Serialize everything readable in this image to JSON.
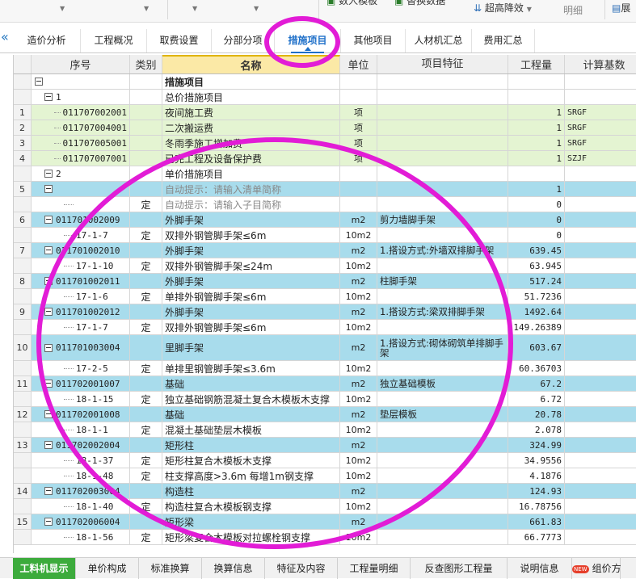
{
  "toolbar": {
    "btn_import": "数人模板",
    "btn_replace": "替换数据",
    "btn_high": "超高降效",
    "btn_detail": "明细",
    "btn_cut": "展"
  },
  "tabs": [
    "造价分析",
    "工程概况",
    "取费设置",
    "分部分项",
    "措施项目",
    "其他项目",
    "人材机汇总",
    "费用汇总"
  ],
  "active_tab": "措施项目",
  "columns": [
    "序号",
    "类别",
    "名称",
    "单位",
    "项目特征",
    "工程量",
    "计算基数"
  ],
  "rows": [
    {
      "idx": "",
      "seq": "",
      "type": "",
      "name": "措施项目",
      "unit": "",
      "feat": "",
      "qty": "",
      "base": "",
      "cls": "root",
      "ind": 0,
      "box": true
    },
    {
      "idx": "",
      "seq": "1",
      "type": "",
      "name": "总价措施项目",
      "unit": "",
      "feat": "",
      "qty": "",
      "base": "",
      "cls": "grp",
      "ind": 1,
      "box": true
    },
    {
      "idx": "1",
      "seq": "011707002001",
      "type": "",
      "name": "夜间施工费",
      "unit": "项",
      "feat": "",
      "qty": "1",
      "base": "SRGF",
      "cls": "item1",
      "ind": 2,
      "box": false
    },
    {
      "idx": "2",
      "seq": "011707004001",
      "type": "",
      "name": "二次搬运费",
      "unit": "项",
      "feat": "",
      "qty": "1",
      "base": "SRGF",
      "cls": "item1",
      "ind": 2,
      "box": false
    },
    {
      "idx": "3",
      "seq": "011707005001",
      "type": "",
      "name": "冬雨季施工增加费",
      "unit": "项",
      "feat": "",
      "qty": "1",
      "base": "SRGF",
      "cls": "item1",
      "ind": 2,
      "box": false
    },
    {
      "idx": "4",
      "seq": "011707007001",
      "type": "",
      "name": "已完工程及设备保护费",
      "unit": "项",
      "feat": "",
      "qty": "1",
      "base": "SZJF",
      "cls": "item1",
      "ind": 2,
      "box": false
    },
    {
      "idx": "",
      "seq": "2",
      "type": "",
      "name": "单价措施项目",
      "unit": "",
      "feat": "",
      "qty": "",
      "base": "",
      "cls": "grp",
      "ind": 1,
      "box": true
    },
    {
      "idx": "5",
      "seq": "",
      "type": "",
      "name": "自动提示：请输入清单简称",
      "unit": "",
      "feat": "",
      "qty": "1",
      "base": "",
      "cls": "item2g",
      "ind": 1,
      "box": true
    },
    {
      "idx": "",
      "seq": "",
      "type": "定",
      "name": "自动提示：请输入子目简称",
      "unit": "",
      "feat": "",
      "qty": "0",
      "base": "",
      "cls": "sub",
      "ind": 3,
      "box": false
    },
    {
      "idx": "6",
      "seq": "011701002009",
      "type": "",
      "name": "外脚手架",
      "unit": "m2",
      "feat": "剪力墙脚手架",
      "qty": "0",
      "base": "",
      "cls": "item2",
      "ind": 1,
      "box": true
    },
    {
      "idx": "",
      "seq": "17-1-7",
      "type": "定",
      "name": "双排外钢管脚手架≤6m",
      "unit": "10m2",
      "feat": "",
      "qty": "0",
      "base": "",
      "cls": "sub",
      "ind": 3,
      "box": false
    },
    {
      "idx": "7",
      "seq": "011701002010",
      "type": "",
      "name": "外脚手架",
      "unit": "m2",
      "feat": "1.搭设方式:外墙双排脚手架",
      "qty": "639.45",
      "base": "",
      "cls": "item2",
      "ind": 1,
      "box": true
    },
    {
      "idx": "",
      "seq": "17-1-10",
      "type": "定",
      "name": "双排外钢管脚手架≤24m",
      "unit": "10m2",
      "feat": "",
      "qty": "63.945",
      "base": "",
      "cls": "sub",
      "ind": 3,
      "box": false
    },
    {
      "idx": "8",
      "seq": "011701002011",
      "type": "",
      "name": "外脚手架",
      "unit": "m2",
      "feat": "柱脚手架",
      "qty": "517.24",
      "base": "",
      "cls": "item2",
      "ind": 1,
      "box": true
    },
    {
      "idx": "",
      "seq": "17-1-6",
      "type": "定",
      "name": "单排外钢管脚手架≤6m",
      "unit": "10m2",
      "feat": "",
      "qty": "51.7236",
      "base": "",
      "cls": "sub",
      "ind": 3,
      "box": false
    },
    {
      "idx": "9",
      "seq": "011701002012",
      "type": "",
      "name": "外脚手架",
      "unit": "m2",
      "feat": "1.搭设方式:梁双排脚手架",
      "qty": "1492.64",
      "base": "",
      "cls": "item2",
      "ind": 1,
      "box": true
    },
    {
      "idx": "",
      "seq": "17-1-7",
      "type": "定",
      "name": "双排外钢管脚手架≤6m",
      "unit": "10m2",
      "feat": "",
      "qty": "149.26389",
      "base": "",
      "cls": "sub",
      "ind": 3,
      "box": false
    },
    {
      "idx": "10",
      "seq": "011701003004",
      "type": "",
      "name": "里脚手架",
      "unit": "m2",
      "feat": "1.搭设方式:砌体砌筑单排脚手架",
      "qty": "603.67",
      "base": "",
      "cls": "item2",
      "ind": 1,
      "box": true,
      "tall": true
    },
    {
      "idx": "",
      "seq": "17-2-5",
      "type": "定",
      "name": "单排里钢管脚手架≤3.6m",
      "unit": "10m2",
      "feat": "",
      "qty": "60.36703",
      "base": "",
      "cls": "sub",
      "ind": 3,
      "box": false
    },
    {
      "idx": "11",
      "seq": "011702001007",
      "type": "",
      "name": "基础",
      "unit": "m2",
      "feat": "独立基础模板",
      "qty": "67.2",
      "base": "",
      "cls": "item2",
      "ind": 1,
      "box": true
    },
    {
      "idx": "",
      "seq": "18-1-15",
      "type": "定",
      "name": "独立基础钢筋混凝土复合木模板木支撑",
      "unit": "10m2",
      "feat": "",
      "qty": "6.72",
      "base": "",
      "cls": "sub",
      "ind": 3,
      "box": false
    },
    {
      "idx": "12",
      "seq": "011702001008",
      "type": "",
      "name": "基础",
      "unit": "m2",
      "feat": "垫层模板",
      "qty": "20.78",
      "base": "",
      "cls": "item2",
      "ind": 1,
      "box": true
    },
    {
      "idx": "",
      "seq": "18-1-1",
      "type": "定",
      "name": "混凝土基础垫层木模板",
      "unit": "10m2",
      "feat": "",
      "qty": "2.078",
      "base": "",
      "cls": "sub",
      "ind": 3,
      "box": false
    },
    {
      "idx": "13",
      "seq": "011702002004",
      "type": "",
      "name": "矩形柱",
      "unit": "m2",
      "feat": "",
      "qty": "324.99",
      "base": "",
      "cls": "item2",
      "ind": 1,
      "box": true
    },
    {
      "idx": "",
      "seq": "18-1-37",
      "type": "定",
      "name": "矩形柱复合木模板木支撑",
      "unit": "10m2",
      "feat": "",
      "qty": "34.9556",
      "base": "",
      "cls": "sub",
      "ind": 3,
      "box": false
    },
    {
      "idx": "",
      "seq": "18-1-48",
      "type": "定",
      "name": "柱支撑高度>3.6m 每增1m钢支撑",
      "unit": "10m2",
      "feat": "",
      "qty": "4.1876",
      "base": "",
      "cls": "sub",
      "ind": 3,
      "box": false
    },
    {
      "idx": "14",
      "seq": "011702003004",
      "type": "",
      "name": "构造柱",
      "unit": "m2",
      "feat": "",
      "qty": "124.93",
      "base": "",
      "cls": "item2",
      "ind": 1,
      "box": true
    },
    {
      "idx": "",
      "seq": "18-1-40",
      "type": "定",
      "name": "构造柱复合木模板钢支撑",
      "unit": "10m2",
      "feat": "",
      "qty": "16.78756",
      "base": "",
      "cls": "sub",
      "ind": 3,
      "box": false
    },
    {
      "idx": "15",
      "seq": "011702006004",
      "type": "",
      "name": "矩形梁",
      "unit": "m2",
      "feat": "",
      "qty": "661.83",
      "base": "",
      "cls": "item2",
      "ind": 1,
      "box": true
    },
    {
      "idx": "",
      "seq": "18-1-56",
      "type": "定",
      "name": "矩形梁复合木模板对拉螺栓钢支撑",
      "unit": "10m2",
      "feat": "",
      "qty": "66.7773",
      "base": "",
      "cls": "sub",
      "ind": 3,
      "box": false
    }
  ],
  "bottom_tabs": [
    "工料机显示",
    "单价构成",
    "标准换算",
    "换算信息",
    "特征及内容",
    "工程量明细",
    "反查图形工程量",
    "说明信息",
    "组价方"
  ],
  "bottom_new_badge": "NEW",
  "colors": {
    "green_row": "#e4f4d2",
    "blue_row": "#a8dcec",
    "annotation": "#e21cd6",
    "header_name": "#fbe9a6",
    "bottom_active": "#3cab3c"
  }
}
